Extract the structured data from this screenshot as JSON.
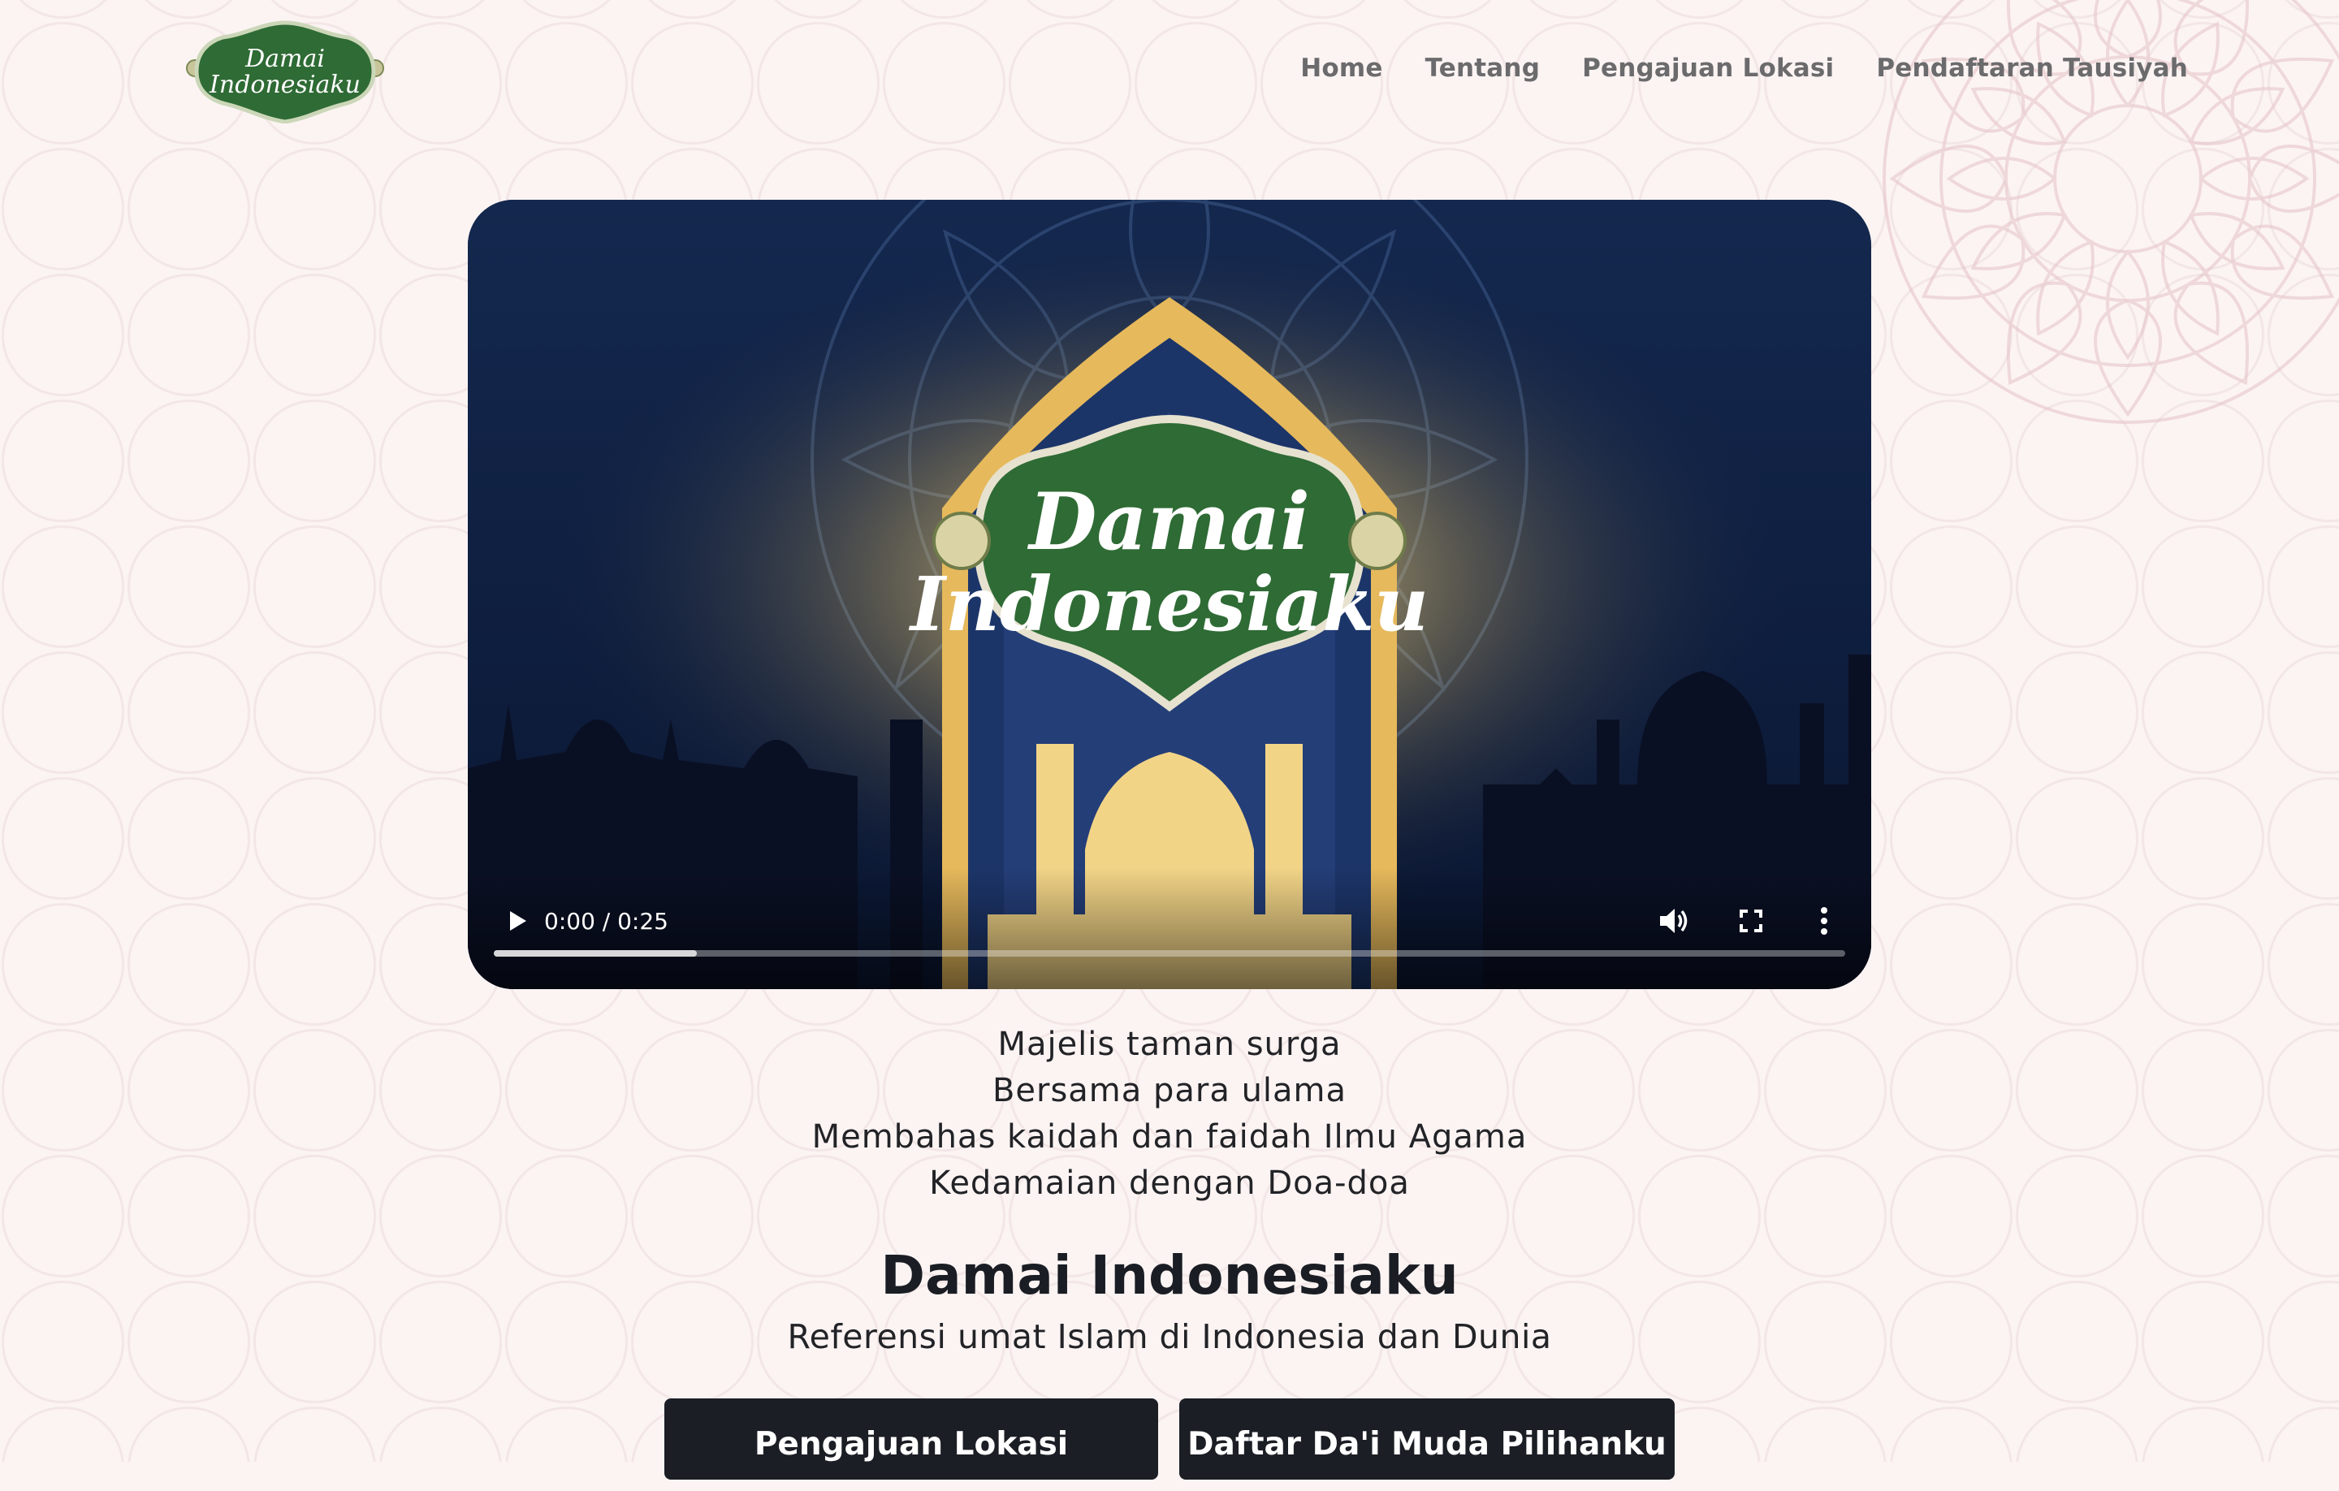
{
  "nav": {
    "logo_text_line1": "Damai",
    "logo_text_line2": "Indonesiaku",
    "items": [
      {
        "label": "Home"
      },
      {
        "label": "Tentang"
      },
      {
        "label": "Pengajuan Lokasi"
      },
      {
        "label": "Pendaftaran Tausiyah"
      }
    ]
  },
  "video": {
    "title_line1": "Damai",
    "title_line2": "Indonesiaku",
    "time_display": "0:00 / 0:25",
    "buffered_fraction": 0.15,
    "controls": [
      "play-icon",
      "volume-icon",
      "fullscreen-icon",
      "more-options-icon"
    ]
  },
  "tagline": [
    "Majelis taman surga",
    "Bersama para ulama",
    "Membahas kaidah dan faidah Ilmu Agama",
    "Kedamaian dengan Doa-doa"
  ],
  "hero": {
    "title": "Damai Indonesiaku",
    "subtitle": "Referensi umat Islam di Indonesia dan Dunia"
  },
  "buttons": {
    "primary": "Pengajuan Lokasi",
    "secondary": "Daftar Da'i Muda Pilihanku"
  },
  "colors": {
    "background": "#fcf4f3",
    "button": "#1b1e24",
    "video_bg": "#0d1b3d",
    "badge_green": "#2f6b35",
    "gold": "#e8c46c"
  }
}
